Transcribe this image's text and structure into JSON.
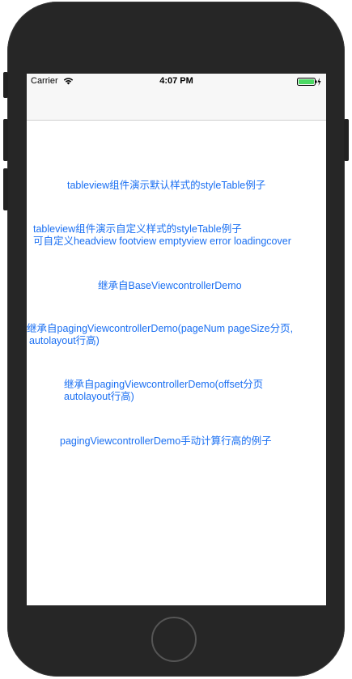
{
  "status_bar": {
    "carrier": "Carrier",
    "time": "4:07 PM",
    "battery_color": "#4cd964"
  },
  "links": {
    "item1": {
      "line1": "tableview组件演示默认样式的styleTable例子"
    },
    "item2": {
      "line1": "tableview组件演示自定义样式的styleTable例子",
      "line2": "可自定义headview footview emptyview error loadingcover"
    },
    "item3": {
      "line1": "继承自BaseViewcontrollerDemo"
    },
    "item4": {
      "line1": "继承自pagingViewcontrollerDemo(pageNum pageSize分页,",
      "line2": "autolayout行高)"
    },
    "item5": {
      "line1": "继承自pagingViewcontrollerDemo(offset分页",
      "line2": "autolayout行高)"
    },
    "item6": {
      "line1": "pagingViewcontrollerDemo手动计算行高的例子"
    }
  },
  "colors": {
    "link": "#1a6ff2",
    "device_body": "#262626"
  }
}
